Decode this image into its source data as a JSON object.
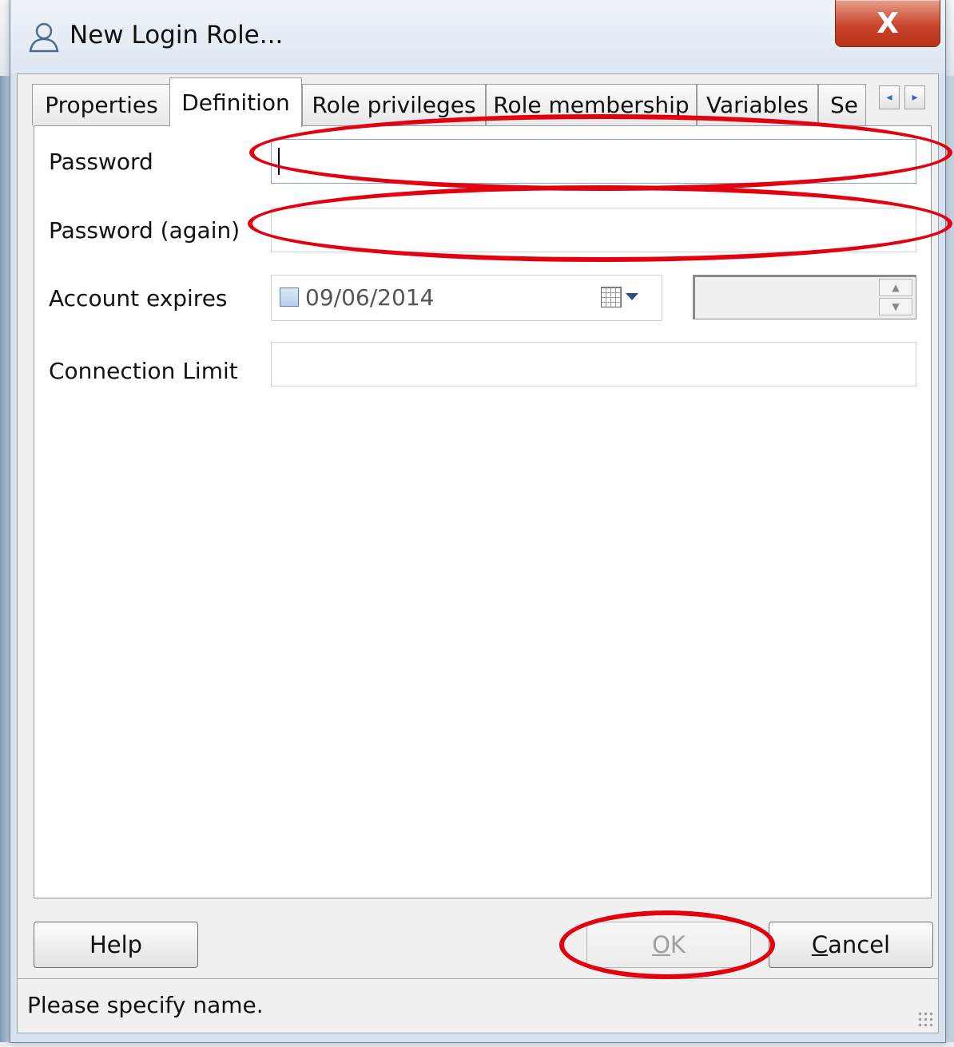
{
  "window": {
    "title": "New Login Role...",
    "close_glyph": "X",
    "icon": "user-icon"
  },
  "tabs": [
    {
      "label": "Properties",
      "active": false
    },
    {
      "label": "Definition",
      "active": true
    },
    {
      "label": "Role privileges",
      "active": false
    },
    {
      "label": "Role membership",
      "active": false
    },
    {
      "label": "Variables",
      "active": false
    },
    {
      "label": "Se",
      "active": false
    }
  ],
  "tab_scroll": {
    "left_glyph": "◂",
    "right_glyph": "▸"
  },
  "form": {
    "password_label": "Password",
    "password_value": "",
    "password_again_label": "Password (again)",
    "password_again_value": "",
    "account_expires_label": "Account expires",
    "account_expires_date": "09/06/2014",
    "account_expires_checked": false,
    "connection_limit_label": "Connection Limit",
    "connection_limit_value": ""
  },
  "buttons": {
    "help": "Help",
    "ok_mnemonic": "O",
    "ok_rest": "K",
    "cancel_mnemonic": "C",
    "cancel_rest": "ancel"
  },
  "status": {
    "message": "Please specify name."
  },
  "colors": {
    "annotation": "#e3000f",
    "close_button": "#c8442b"
  }
}
